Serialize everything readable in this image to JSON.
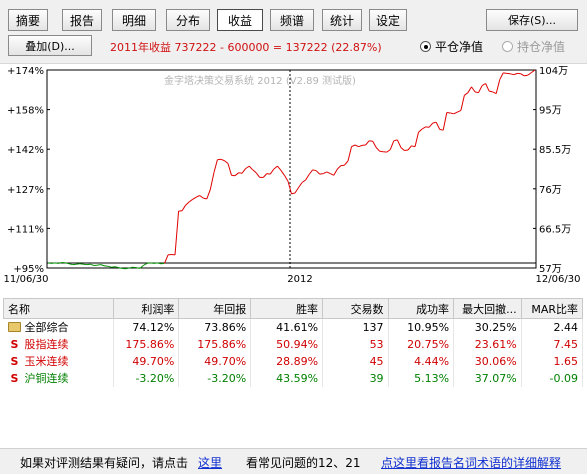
{
  "tabs": [
    {
      "label": "摘要",
      "active": false
    },
    {
      "label": "报告",
      "active": false
    },
    {
      "label": "明细",
      "active": false
    },
    {
      "label": "分布",
      "active": false
    },
    {
      "label": "收益",
      "active": true
    },
    {
      "label": "频谱",
      "active": false
    },
    {
      "label": "统计",
      "active": false
    },
    {
      "label": "设定",
      "active": false
    }
  ],
  "toolbar": {
    "save_label": "保存(S)...",
    "overlay_label": "叠加(D)...",
    "summary": "2011年收益 737222 - 600000 = 137222 (22.87%)",
    "radio_flat": "平仓净值",
    "radio_hold": "持仓净值"
  },
  "chart": {
    "watermark": "金字塔决策交易系统 2012 (V2.89 测试版)",
    "left_ticks": [
      "+174%",
      "+158%",
      "+142%",
      "+127%",
      "+111%",
      "+95%"
    ],
    "right_ticks": [
      "104万",
      "95万",
      "85.5万",
      "76万",
      "66.5万",
      "57万"
    ],
    "x_left": "11/06/30",
    "x_mid": "2012",
    "x_right": "12/06/30",
    "colors": {
      "up": "#e00000",
      "down": "#009000",
      "baseline": "#000000"
    }
  },
  "chart_data": {
    "type": "line",
    "xlabel": "",
    "ylabel": "",
    "ylim": [
      57,
      104
    ],
    "y_unit": "万",
    "x_range": [
      "11/06/30",
      "12/06/30"
    ],
    "series": [
      {
        "values": [
          58.2,
          58.1,
          58.2,
          58.1,
          58.3,
          58.2,
          58.0,
          57.8,
          57.9,
          58.0,
          57.9,
          57.8,
          57.9,
          57.6,
          57.7,
          57.8,
          57.5,
          57.4,
          57.2,
          57.3,
          57.1,
          56.9,
          56.8,
          57.0,
          57.2,
          57.1,
          56.9,
          57.6,
          58.1,
          58.2,
          58.1,
          58.2,
          58.0,
          58.1,
          60.1,
          60.2,
          60.1,
          70.5,
          70.6,
          71.9,
          72.7,
          73.3,
          73.8,
          74.2,
          73.6,
          73.4,
          75.6,
          79.6,
          82.7,
          82.8,
          82.5,
          81.8,
          79.0,
          78.9,
          79.6,
          79.5,
          80.6,
          81.2,
          80.3,
          79.6,
          78.5,
          78.5,
          79.4,
          79.3,
          80.5,
          81.2,
          80.2,
          79.0,
          77.6,
          74.6,
          74.8,
          76.1,
          77.3,
          77.9,
          79.2,
          80.3,
          80.1,
          79.3,
          79.4,
          79.8,
          79.4,
          79.0,
          80.5,
          81.3,
          81.4,
          82.4,
          85.8,
          86.2,
          85.8,
          86.1,
          86.2,
          87.2,
          87.1,
          85.6,
          84.7,
          84.6,
          84.5,
          85.1,
          87.2,
          87.4,
          85.6,
          84.9,
          85.0,
          86.0,
          85.8,
          89.2,
          90.0,
          90.5,
          90.4,
          91.4,
          91.6,
          89.9,
          89.7,
          93.9,
          93.8,
          93.6,
          94.0,
          94.4,
          98.0,
          98.6,
          100.0,
          98.8,
          98.6,
          100.3,
          100.8,
          99.0,
          98.8,
          98.4,
          101.7,
          103.3,
          103.2,
          103.1,
          102.9,
          103.2,
          103.1,
          102.6,
          102.8,
          103.4,
          104.0
        ]
      }
    ]
  },
  "table": {
    "headers": [
      "名称",
      "利润率",
      "年回报",
      "胜率",
      "交易数",
      "成功率",
      "最大回撤...",
      "MAR比率"
    ],
    "rows": [
      {
        "icon": "folder-icon",
        "mark": "",
        "name": "全部综合",
        "cells": [
          "74.12%",
          "73.86%",
          "41.61%",
          "137",
          "10.95%",
          "30.25%",
          "2.44"
        ],
        "color": "#000000"
      },
      {
        "icon": "s-icon",
        "mark": "S",
        "name": "股指连续",
        "cells": [
          "175.86%",
          "175.86%",
          "50.94%",
          "53",
          "20.75%",
          "23.61%",
          "7.45"
        ],
        "color": "#d00000"
      },
      {
        "icon": "s-icon",
        "mark": "S",
        "name": "玉米连续",
        "cells": [
          "49.70%",
          "49.70%",
          "28.89%",
          "45",
          "4.44%",
          "30.06%",
          "1.65"
        ],
        "color": "#d00000"
      },
      {
        "icon": "s-icon",
        "mark": "S",
        "name": "沪铜连续",
        "cells": [
          "-3.20%",
          "-3.20%",
          "43.59%",
          "39",
          "5.13%",
          "37.07%",
          "-0.09"
        ],
        "color": "#008000"
      }
    ]
  },
  "footer": {
    "question_text": "如果对评测结果有疑问，请点击",
    "here_link": "这里",
    "faq_text": "看常见问题的12、21",
    "glossary_link": "点这里看报告名词术语的详细解释"
  }
}
